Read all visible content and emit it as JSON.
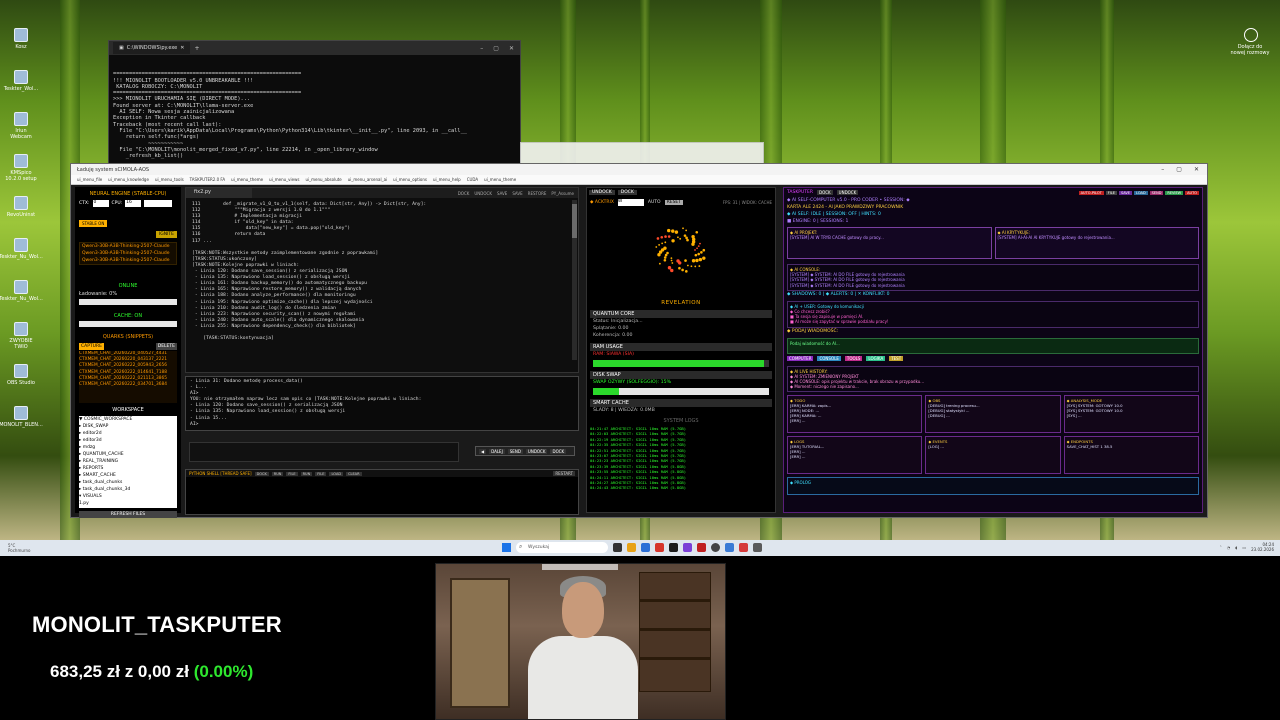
{
  "desktop": {
    "icons": [
      {
        "label": "Kosz",
        "icon": "recycle-bin-icon"
      },
      {
        "label": "Teskter_Wol...",
        "icon": "folder-icon"
      },
      {
        "label": "Iriun Webcam",
        "icon": "webcam-app-icon"
      },
      {
        "label": "KMSpico 10.2.0 setup",
        "icon": "installer-icon"
      },
      {
        "label": "RevoUninst",
        "icon": "uninstaller-icon"
      },
      {
        "label": "Teskter_Nu_Wol...",
        "icon": "folder-icon"
      },
      {
        "label": "Teskter_Nu_Wol...",
        "icon": "folder-icon"
      },
      {
        "label": "ZWYOBIE TWIO",
        "icon": "shortcut-icon"
      },
      {
        "label": "OBS Studio",
        "icon": "obs-icon"
      },
      {
        "label": "MONOLIT_BLEN...",
        "icon": "folder-icon"
      }
    ],
    "top_right_label": "Dołącz do nowej rozmowy"
  },
  "console": {
    "tab_title": "C:\\WINDOWS\\py.exe",
    "lines": [
      "",
      "===========================================================",
      "!!! MIONOLIT BOOTLOADER v5.0 UNBREAKABLE !!!",
      " KATALOG ROBOCZY: C:\\MONOLIT",
      "===========================================================",
      ">>> MIONOLIT URUCHAMIA SIĘ (DIRECT MODE)...",
      "Found server at: C:\\MONOLIT\\llama-server.exe",
      "  AI SELF: Nowa sesja zainicjalizowana",
      "Exception in Tkinter callback",
      "Traceback (most recent call last):",
      "  File \"C:\\Users\\karik\\AppData\\Local\\Programs\\Python\\Python314\\Lib\\tkinter\\__init__.py\", line 2093, in __call__",
      "    return self.func(*args)",
      "           ~~~~~~~~~~~",
      "  File \"C:\\MONOLIT\\monolit_merged_fixed_v7.py\", line 22214, in _open_library_window",
      "    _refresh_kb_list()"
    ]
  },
  "app": {
    "title": "Ładuję system sCIMOLA-AOS",
    "menu": [
      "ui_menu_file",
      "ui_menu_knowledge",
      "ui_menu_tools",
      "TASKPUTER2.0 FA",
      "ui_menu_theme",
      "ui_menu_views",
      "ui_menu_absolute",
      "ui_menu_arsenal_ai",
      "ui_menu_options",
      "ui_menu_help",
      "CUDA",
      "ui_menu_theme"
    ]
  },
  "left_panel": {
    "title": "NEURAL ENGINE (STABLE-CPU)",
    "ctx_label": "CTX:",
    "ctx_value": "0",
    "cpu_label": "CPU:",
    "cpu_value": "16",
    "stable_label": "STABLE ON",
    "ignite_label": "IGNITE",
    "models": [
      "Qwen3-30B-A3B-Thinking-2507-Claude",
      "Qwen3-30B-A3B-Thinking-2507-Claude",
      "Qwen3-30B-A3B-Thinking-2507-Claude"
    ],
    "online_label": "ONLINE",
    "loading_label": "Ładowanie: 0%",
    "cache_label": "CACHE: ON",
    "quarks_label": "QUARKS (SNIPPETS)",
    "capture_label": "CAPTURE",
    "delete_label": "DELETE",
    "snapshots": [
      "CTXMEM_CHAT_20260220_040527_4431",
      "CTXMEM_CHAT_20260220_043137_2221",
      "CTXMEM_CHAT_20260222_005943_2656",
      "CTXMEM_CHAT_20260222_014641_7188",
      "CTXMEM_CHAT_20260222_021113_3865",
      "CTXMEM_CHAT_20260222_034701_3684"
    ],
    "workspace_label": "WORKSPACE",
    "tree": [
      "▼ COSMIC_WORKSPACE",
      "  ▸ DISK_SWAP",
      "  ▸ editor2d",
      "  ▸ editor3d",
      "  ▸ mdzg",
      "  ▸ QUANTUM_CACHE",
      "  ▸ REAL_TRAINING",
      "  ▸ REPORTS",
      "  ▸ SMART_CACHE",
      "  ▸ task_dual_chunks",
      "  ▸ task_dual_chunks_3d",
      "  ▾ VISUALS",
      "     1.py"
    ],
    "refresh_label": "REFRESH FILES"
  },
  "editor": {
    "tab": "fix2.py",
    "actions": [
      "DOCK",
      "UNDOCK",
      "SAVE",
      "SAVE",
      "RESTORE",
      "PY_Assume"
    ],
    "lines": [
      "111        def _migrate_v1_0_to_v1_1(self, data: Dict[str, Any]) -> Dict[str, Any]:",
      "112            \"\"\"Migracja z wersji 1.0 do 1.1\"\"\"",
      "113            # Implementacja migracji",
      "114            if \"old_key\" in data:",
      "115                data[\"new_key\"] = data.pop(\"old_key\")",
      "116            return data",
      "117 ...",
      "",
      "[TASK:NOTE:Wszystkie metody zaimplementowane zgodnie z poprawkami]",
      "[TASK:STATUS:ukończony]",
      "[TASK:NOTE:Kolejne poprawki w liniach:",
      " - Linia 120: Dodano save_session() z serializacją JSON",
      " - Linia 135: Naprawiono load_session() z obsługą wersji",
      " - Linia 161: Dodano backup_memory() do automatycznego backupu",
      " - Linia 165: Naprawiono restore_memory() z walidacją danych",
      " - Linia 188: Dodano analyze_performance() dla monitoringu",
      " - Linia 195: Naprawiono optimize_cache() dla lepszej wydajności",
      " - Linia 210: Dodano audit_log() do śledzenia zmian",
      " - Linia 223: Naprawiono security_scan() z nowymi regułami",
      " - Linia 240: Dodano auto_scale() dla dynamicznego skalowania",
      " - Linia 255: Naprawiono dependency_check() dla bibliotek]",
      "",
      "    [TASK:STATUS:kontynuacja]"
    ]
  },
  "chatlog": {
    "lines": [
      "- Linia 31: Dodano metodę process_data()",
      "- L...",
      "AI>",
      "YOU: nie otrzymałem napraw lecz sam opis co [TASK:NOTE:Kolejne poprawki w liniach:",
      "- Linia 120: Dodano save_session() z serializacją JSON",
      "- Linia 135: Naprawiono load_session() z obsługą wersji",
      "- Linia 15...",
      "AI>"
    ]
  },
  "send_bar": [
    "◀",
    "DALEJ",
    "SEND",
    "UNDOCK",
    "DOCK"
  ],
  "pyshell": {
    "label": "PYTHON SHELL [THREAD SAFE]",
    "buttons": [
      "DOCK",
      "RUN",
      "FILE",
      "RUN",
      "FILE",
      "LOAD",
      "CLEAR"
    ],
    "restart_label": "RESTART"
  },
  "quantum": {
    "top_buttons": [
      "UNDOCK",
      "DOCK"
    ],
    "actrix_label": "◆ ACKTRIX",
    "mode_value": "W",
    "auto_label": "AUTO",
    "reset_label": "RESET",
    "fps_text": "FPS: 31 | WIDOK: CACHE",
    "revelation": "REVELATION",
    "core_head": "QUANTUM CORE",
    "status": "Status: Inicjalizacja...",
    "splatanie": "Splątanie: 0.00",
    "koherencja": "Koherencja: 0.00",
    "ram_head": "RAM USAGE",
    "ram_label": "RAM: SIAWA (SIA)",
    "ram_fraction": 0.97,
    "swap_head": "DISK SWAP",
    "swap_label": "SWAP OZYWY (SOLFEGGIO): 15%",
    "swap_fraction": 0.15,
    "smart_head": "SMART CACHE",
    "slady": "ŚLADY: 8 | WIEDZA: 0.0MB",
    "syslog_title": "SYSTEM LOGS",
    "syslog": [
      "04:21:47 ARCHITECT: SIGIL 10ms RAM (5.7GB)",
      "04:22:03 ARCHITECT: SIGIL 10ms RAM (5.7GB)",
      "04:22:19 ARCHITECT: SIGIL 10ms RAM (5.7GB)",
      "04:22:35 ARCHITECT: SIGIL 10ms RAM (5.7GB)",
      "04:22:51 ARCHITECT: SIGIL 10ms RAM (5.7GB)",
      "04:23:07 ARCHITECT: SIGIL 10ms RAM (5.7GB)",
      "04:23:23 ARCHITECT: SIGIL 10ms RAM (5.7GB)",
      "04:23:39 ARCHITECT: SIGIL 10ms RAM (5.8GB)",
      "04:23:55 ARCHITECT: SIGIL 10ms RAM (5.8GB)",
      "04:24:11 ARCHITECT: SIGIL 10ms RAM (5.8GB)",
      "04:24:27 ARCHITECT: SIGIL 10ms RAM (5.8GB)",
      "04:24:43 ARCHITECT: SIGIL 10ms RAM (5.8GB)"
    ]
  },
  "right_panel": {
    "title": "TASKPUTER",
    "head_buttons": [
      "DOCK",
      "UNDOCK"
    ],
    "pills": [
      "AUTO-PILOT",
      "FILE",
      "SAVE",
      "LOAD",
      "SEND",
      "REVIEW",
      "AUTO"
    ],
    "line1": "◆ AI SELF-COMPUTER v5.0 - PRO CODER • SESSION: ◆",
    "line2": "KARTA ALE 2424 - AI JAKO PRAWDZIWY PRACOWNIK",
    "line3": "◆ AI SELF: IDLE | SESSION: OFF | HINTS: 0",
    "line4": "■ ENGINE: 0 | SESSIONS: 1",
    "box_left": [
      "◆ AI PROJEKT:",
      "[SYSTEM] AI W TRYB CACHE gotowy do pracy..."
    ],
    "box_right": [
      "◆ AI KRYTYKUJE:",
      "[SYSTEM] AI-AI-AI AI KRYTYKUJE gotowy do rejestrowania..."
    ],
    "wide1": [
      "◆ AI CONSOLE:",
      "[SYSTEM] ◆ SYSTEM: AI DO FILE gotowy do rejestrowania",
      "[SYSTEM] ◆ SYSTEM: AI DO FILE gotowy do rejestrowania",
      "[SYSTEM] ◆ SYSTEM: AI DO FILE gotowy do rejestrowania"
    ],
    "agents_line": "◆ SHADOWS: 0 | ◆ ALERTS: 0 | ✕ KONFLIKT: 0",
    "wide2": [
      "◆ AI + USER: Gotowy do komunikacji",
      "◆ Co chcesz zrobić?",
      "■ Ta sesja się zapisuje w pamięci AI.",
      "■ AI może się zapytać w sprawie podziału pracy!"
    ],
    "prompt_label": "◆ PODAJ WIADOMOŚĆ:",
    "prompt_hint": "Podaj wiadomość do AI...",
    "section_buttons": [
      "COMPUTER",
      "CONSOLE",
      "TOOLS",
      "LOGIKA",
      "TEST"
    ],
    "wide3": [
      "◆ AI LIVE HISTORY:",
      "◆ AI SYSTEM: ZMIENIONY PROJEKT",
      "◆ AI CONSOLE: opis projektu w trakcie, brak obrazu w przypadku...",
      "◆ Moment: niczego nie zapisano..."
    ],
    "cells": [
      [
        "◆ TODO",
        "[ERR] KARMA: zapis...",
        "[ERR] NODE: ...",
        "[ERR] KARMA: ...",
        "[ERR] ..."
      ],
      [
        "◆ OBS",
        "[DEBUG] trening procesu...",
        "[DEBUG] statystyki ...",
        "[DEBUG] ..."
      ],
      [
        "◆ ANALYSIS_MODE",
        "[SYS] SYSTEM: GOTOWY 10.0",
        "[SYS] SYSTEM: GOTOWY 10.0",
        "[SYS] ..."
      ]
    ],
    "cells2": [
      [
        "◆ LOGS",
        "[ERR] TUTORIAL...",
        "[ERR] ...",
        "[ERR] ..."
      ],
      [
        "◆ EVENTS",
        "[LOG] ..."
      ],
      [
        "◆ ENDPOINTS",
        "SAVE_CHAT_HIST 1 38.5"
      ]
    ],
    "bottom_label": "◆ PROLOG"
  },
  "taskbar": {
    "left_text": "5°C\nPochmurno",
    "search_placeholder": "Wyszukaj",
    "clock_time": "04:24",
    "clock_date": "23.02.2026"
  },
  "overlay": {
    "title": "MONOLIT_TASKPUTER",
    "price_value": "683,25 zł",
    "price_z": "z",
    "price_base": "0,00 zł",
    "price_pct": "(0.00%)"
  },
  "colors": {
    "accent_orange": "#ffb000",
    "neon_green": "#2eff2e",
    "purple": "#e040ff",
    "gain_green": "#2ee82e"
  }
}
